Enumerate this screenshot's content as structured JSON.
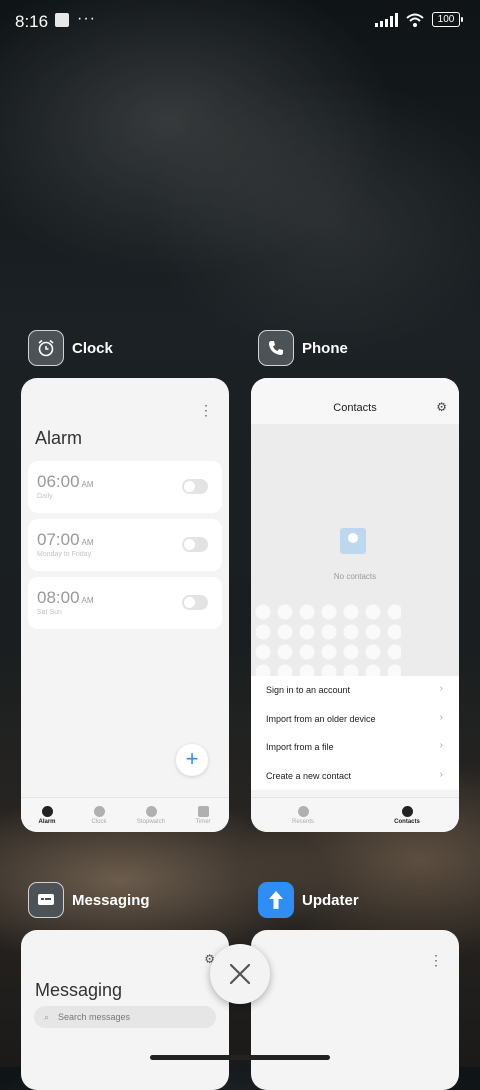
{
  "status_bar": {
    "time": "8:16",
    "more": "···",
    "battery": "100"
  },
  "apps": [
    {
      "name": "Clock",
      "title": "Alarm",
      "alarms": [
        {
          "time": "06:00",
          "ampm": "AM",
          "sub": "Daily"
        },
        {
          "time": "07:00",
          "ampm": "AM",
          "sub": "Monday to Friday"
        },
        {
          "time": "08:00",
          "ampm": "AM",
          "sub": "Sat Sun"
        }
      ],
      "tabs": [
        "Alarm",
        "Clock",
        "Stopwatch",
        "Timer"
      ]
    },
    {
      "name": "Phone",
      "title": "Contacts",
      "empty_text": "No contacts",
      "menu": [
        "Sign in to an account",
        "Import from an older device",
        "Import from a file",
        "Create a new contact"
      ],
      "tabs": [
        "Recents",
        "Contacts"
      ]
    },
    {
      "name": "Messaging",
      "title": "Messaging",
      "search_placeholder": "Search messages"
    },
    {
      "name": "Updater"
    }
  ]
}
